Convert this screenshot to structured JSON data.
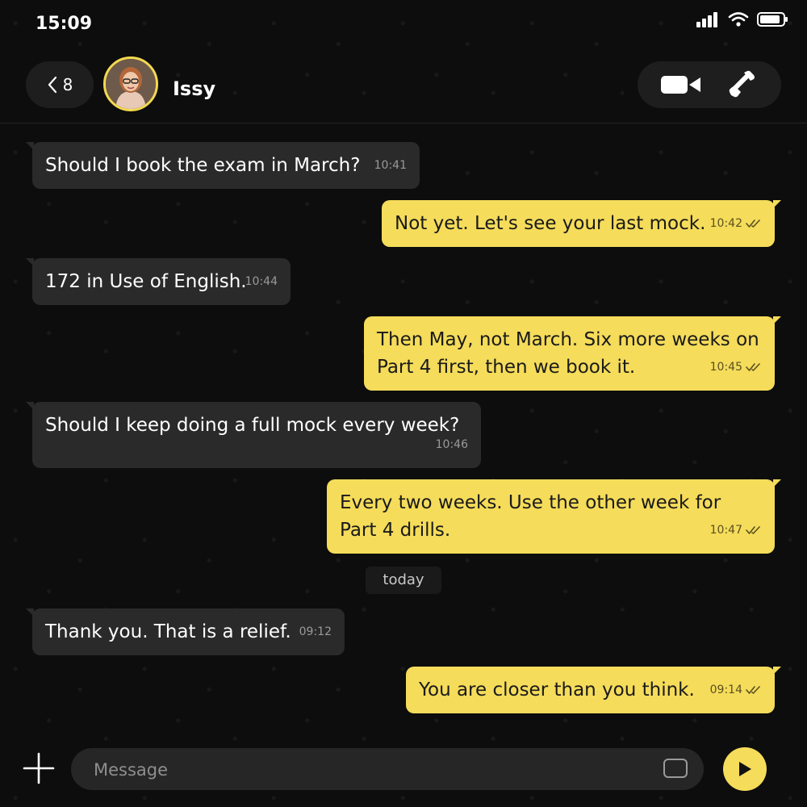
{
  "status_bar": {
    "time": "15:09"
  },
  "header": {
    "back_count": "8",
    "contact_name": "Issy"
  },
  "messages": [
    {
      "direction": "in",
      "text": "Should I book the exam in March?",
      "time": "10:41"
    },
    {
      "direction": "out",
      "text": "Not yet. Let's see your last mock.",
      "time": "10:42",
      "read": true
    },
    {
      "direction": "in",
      "text": "172 in Use of English.",
      "time": "10:44"
    },
    {
      "direction": "out",
      "text": "Then May, not March. Six more weeks on Part 4 first, then we book it.",
      "time": "10:45",
      "read": true
    },
    {
      "direction": "in",
      "text": "Should I keep doing a full mock every week?",
      "time": "10:46"
    },
    {
      "direction": "out",
      "text": "Every two weeks. Use the other week for Part 4 drills.",
      "time": "10:47",
      "read": true
    },
    {
      "direction": "in",
      "text": "Thank you. That is a relief.",
      "time": "09:12"
    },
    {
      "direction": "out",
      "text": "You are closer than you think.",
      "time": "09:14",
      "read": true
    }
  ],
  "date_separator": "today",
  "composer": {
    "placeholder": "Message"
  },
  "colors": {
    "accent": "#f5dc5a",
    "incoming_bubble": "#2a2a2a",
    "background": "#0d0d0d"
  },
  "icons": [
    "signal-icon",
    "wifi-icon",
    "battery-icon",
    "chevron-left-icon",
    "video-camera-icon",
    "phone-icon",
    "read-check-icon",
    "plus-icon",
    "sticker-icon",
    "send-icon"
  ]
}
